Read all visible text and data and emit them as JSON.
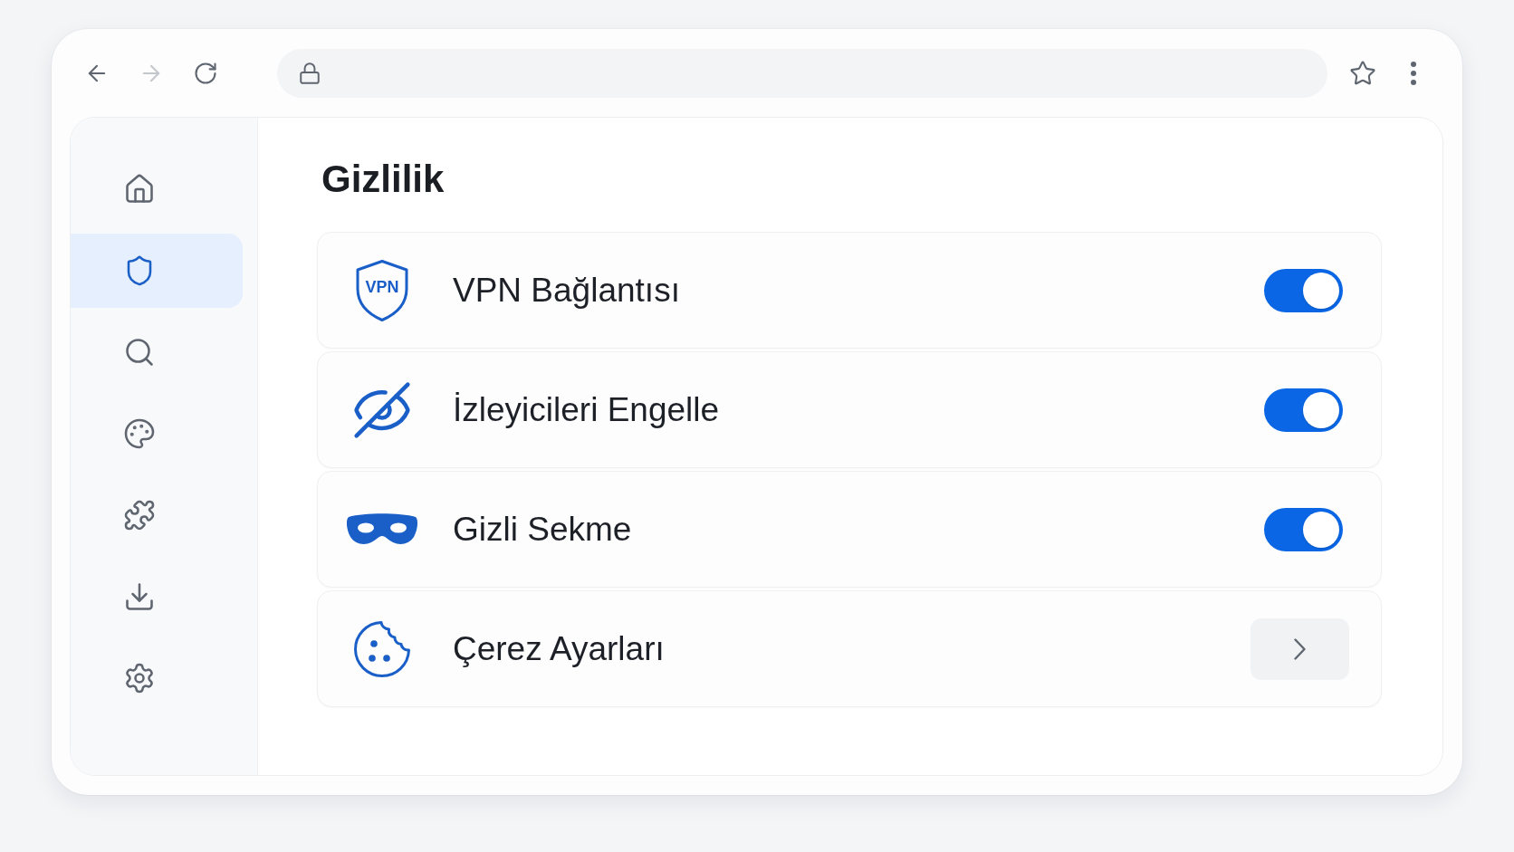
{
  "toolbar": {
    "nav_buttons": [
      {
        "disabled": false
      },
      {
        "disabled": true
      },
      {
        "disabled": false
      }
    ]
  },
  "sidebar": {
    "items": [
      {
        "selected": false
      },
      {
        "selected": true
      },
      {
        "selected": false
      },
      {
        "selected": false
      },
      {
        "selected": false
      },
      {
        "selected": false
      },
      {
        "selected": false
      }
    ]
  },
  "page": {
    "title": "Gizlilik"
  },
  "rows": [
    {
      "kind": "toggle",
      "icon_text": "VPN",
      "label": "VPN Bağlantısı",
      "on": true
    },
    {
      "kind": "toggle",
      "label": "İzleyicileri Engelle",
      "on": true
    },
    {
      "kind": "toggle",
      "label": "Gizli Sekme",
      "on": true
    },
    {
      "kind": "link",
      "label": "Çerez Ayarları"
    }
  ]
}
